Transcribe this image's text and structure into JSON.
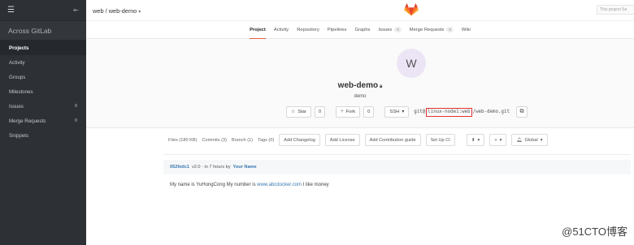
{
  "sidebar": {
    "brand": "Across GitLab",
    "items": [
      {
        "label": "Projects",
        "count": ""
      },
      {
        "label": "Activity",
        "count": ""
      },
      {
        "label": "Groups",
        "count": ""
      },
      {
        "label": "Milestones",
        "count": ""
      },
      {
        "label": "Issues",
        "count": "0"
      },
      {
        "label": "Merge Requests",
        "count": "0"
      },
      {
        "label": "Snippets",
        "count": ""
      }
    ]
  },
  "topbar": {
    "breadcrumb": "web / web-demo",
    "search_text": "This project Se"
  },
  "nav": {
    "tabs": [
      {
        "label": "Project",
        "badge": ""
      },
      {
        "label": "Activity",
        "badge": ""
      },
      {
        "label": "Repository",
        "badge": ""
      },
      {
        "label": "Pipelines",
        "badge": ""
      },
      {
        "label": "Graphs",
        "badge": ""
      },
      {
        "label": "Issues",
        "badge": "0"
      },
      {
        "label": "Merge Requests",
        "badge": "0"
      },
      {
        "label": "Wiki",
        "badge": ""
      }
    ]
  },
  "project": {
    "avatar_letter": "W",
    "name": "web-demo",
    "description": "demo",
    "star_label": "Star",
    "star_count": "0",
    "fork_label": "Fork",
    "fork_count": "0",
    "protocol": "SSH",
    "clone_prefix": "git@",
    "clone_highlight": "linux-node1:web",
    "clone_suffix": "/web-demo.git"
  },
  "files": {
    "links": [
      "Files (180 KB)",
      "Commits (3)",
      "Branch (1)",
      "Tags (0)"
    ],
    "buttons": [
      "Add Changelog",
      "Add License",
      "Add Contribution guide",
      "Set Up CI"
    ],
    "global_label": "Global"
  },
  "commit": {
    "sha": "052fedc1",
    "message": "v2.0 · in 7 hours by",
    "author": "Your Name"
  },
  "readme": {
    "text_before": "My name is YuHongCong My number is",
    "link": "www.abcdocker.com",
    "text_after": "I like money"
  },
  "watermark": "@51CTO博客",
  "colors": {
    "sidebar_bg": "#2d3035",
    "accent_tab": "#e75e40",
    "link": "#3777b0",
    "highlight_box": "#e23333"
  }
}
